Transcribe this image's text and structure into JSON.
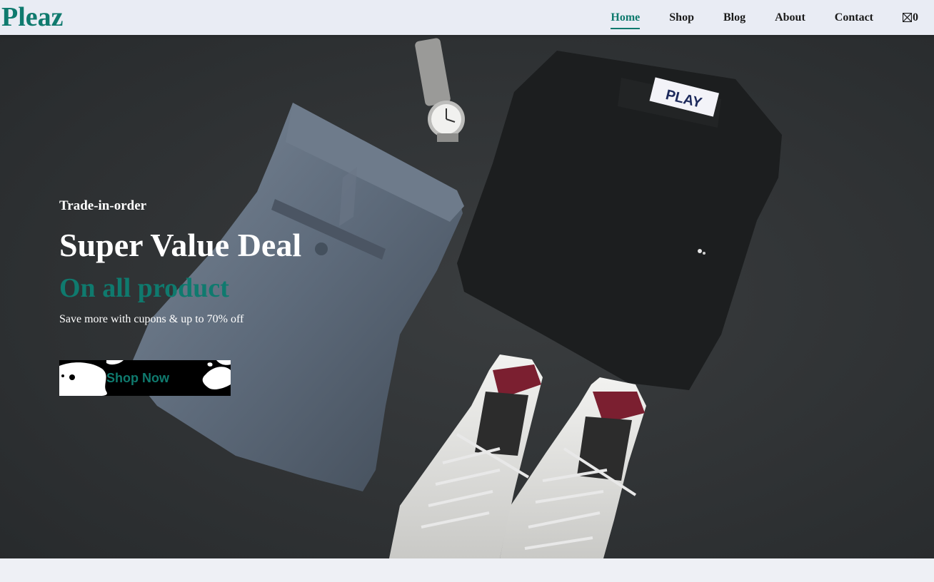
{
  "header": {
    "logo": "Pleaz",
    "nav": [
      {
        "label": "Home",
        "active": true
      },
      {
        "label": "Shop",
        "active": false
      },
      {
        "label": "Blog",
        "active": false
      },
      {
        "label": "About",
        "active": false
      },
      {
        "label": "Contact",
        "active": false
      }
    ],
    "cart_count": "0",
    "cart_icon": "shopping-bag-icon"
  },
  "hero": {
    "kicker": "Trade-in-order",
    "headline": "Super Value Deal",
    "subheadline": "On all product",
    "description": "Save more with cupons & up to 70% off",
    "button_label": "Shop Now",
    "tshirt_label": "PLAY"
  },
  "colors": {
    "brand": "#0f7a6e",
    "nav_background": "#e9ecf4",
    "hero_background": "#2f3234",
    "page_background": "#eef0f5"
  }
}
